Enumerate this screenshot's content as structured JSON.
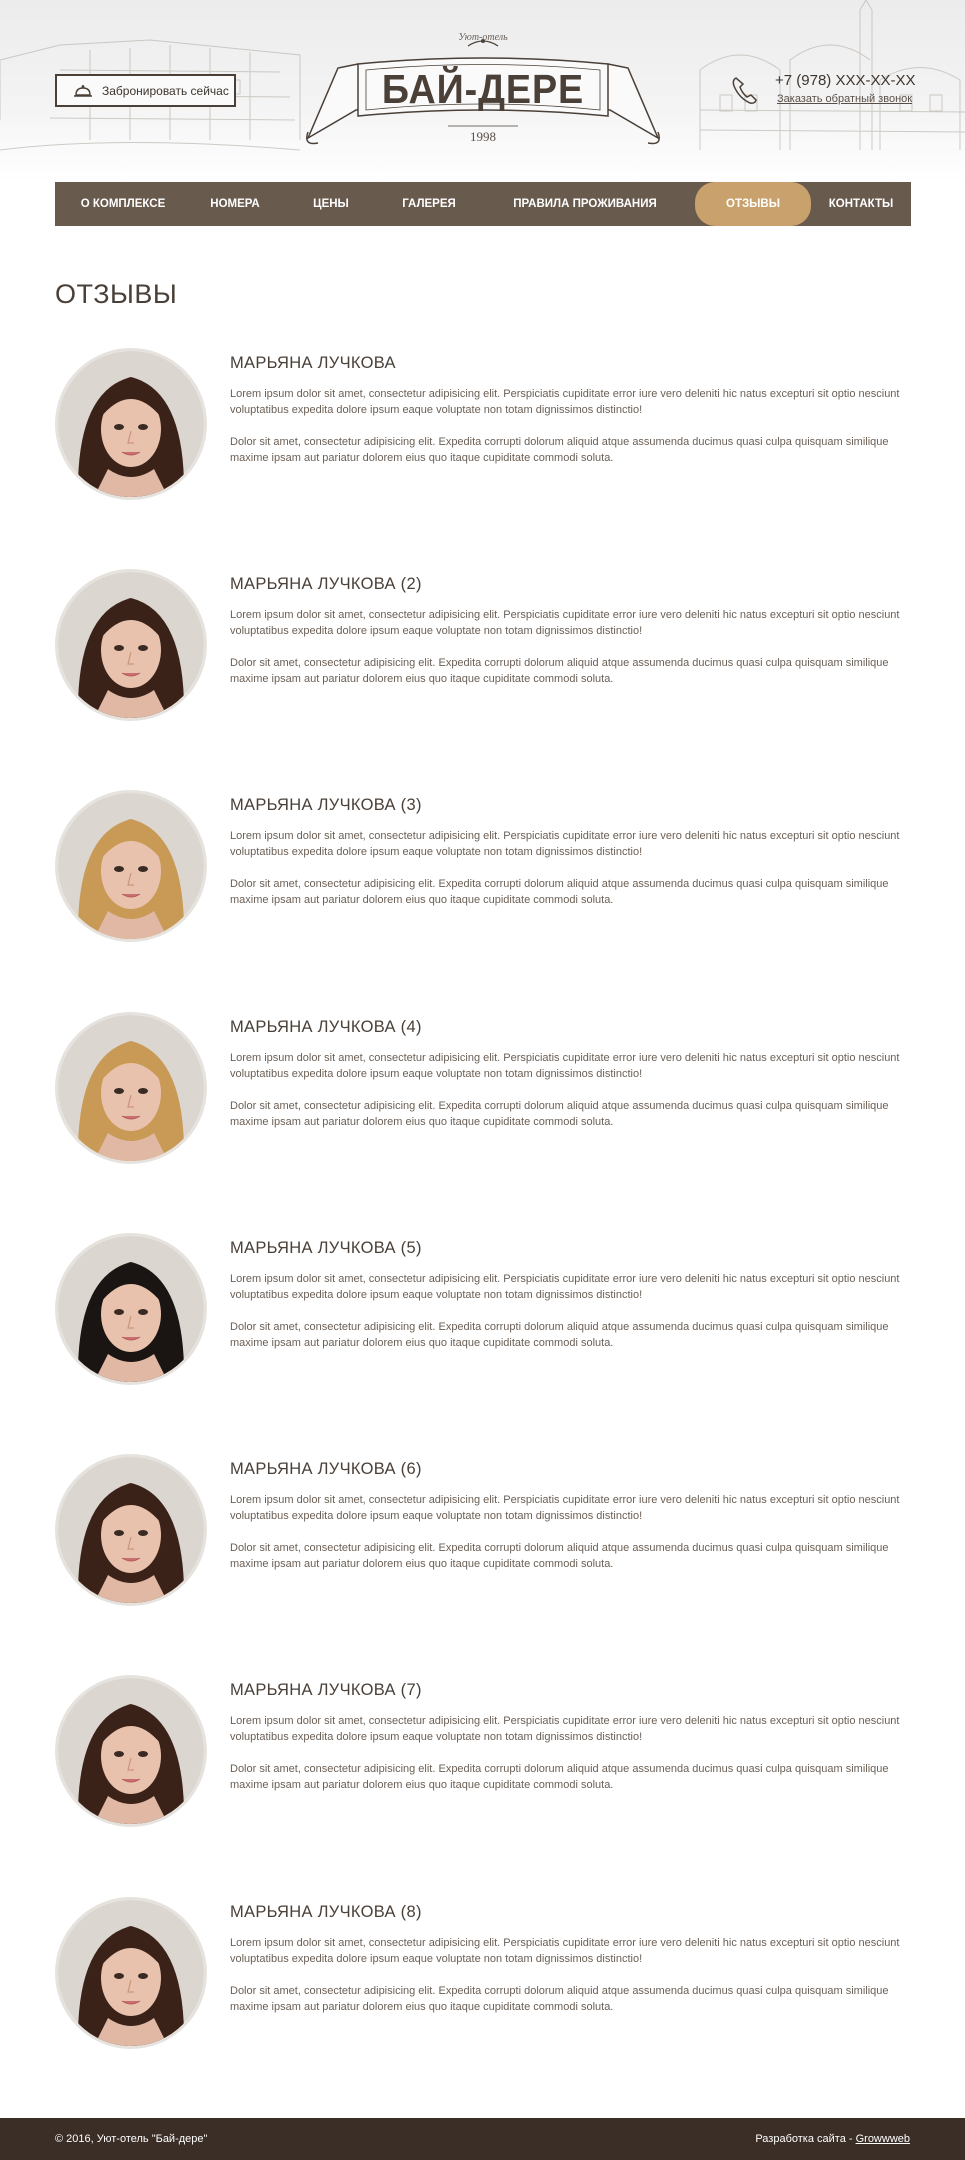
{
  "header": {
    "book_button": "Забронировать сейчас",
    "logo_subtitle": "Уют-отель",
    "logo_title": "БАЙ-ДЕРЕ",
    "logo_year": "1998",
    "phone": "+7 (978) XXX-XX-XX",
    "callback": "Заказать обратный звонок"
  },
  "nav": {
    "items": [
      {
        "label": "О комплексе"
      },
      {
        "label": "Номера"
      },
      {
        "label": "Цены"
      },
      {
        "label": "Галерея"
      },
      {
        "label": "Правила проживания"
      },
      {
        "label": "Отзывы",
        "active": true
      },
      {
        "label": "Контакты"
      }
    ]
  },
  "page": {
    "title": "ОТЗЫВЫ"
  },
  "reviews": [
    {
      "name": "МАРЬЯНА ЛУЧКОВА",
      "p1": "Lorem ipsum dolor sit amet, consectetur adipisicing elit. Perspiciatis cupiditate error iure vero deleniti hic natus excepturi sit optio nesciunt voluptatibus expedita dolore ipsum eaque voluptate non totam dignissimos distinctio!",
      "p2": "Dolor sit amet, consectetur adipisicing elit. Expedita corrupti dolorum aliquid atque assumenda ducimus quasi culpa quisquam similique maxime ipsam aut pariatur dolorem eius quo itaque cupiditate commodi soluta.",
      "hair": "dark-brown"
    },
    {
      "name": "МАРЬЯНА ЛУЧКОВА (2)",
      "p1": "Lorem ipsum dolor sit amet, consectetur adipisicing elit. Perspiciatis cupiditate error iure vero deleniti hic natus excepturi sit optio nesciunt voluptatibus expedita dolore ipsum eaque voluptate non totam dignissimos distinctio!",
      "p2": "Dolor sit amet, consectetur adipisicing elit. Expedita corrupti dolorum aliquid atque assumenda ducimus quasi culpa quisquam similique maxime ipsam aut pariatur dolorem eius quo itaque cupiditate commodi soluta.",
      "hair": "dark-brown"
    },
    {
      "name": "МАРЬЯНА ЛУЧКОВА (3)",
      "p1": "Lorem ipsum dolor sit amet, consectetur adipisicing elit. Perspiciatis cupiditate error iure vero deleniti hic natus excepturi sit optio nesciunt voluptatibus expedita dolore ipsum eaque voluptate non totam dignissimos distinctio!",
      "p2": "Dolor sit amet, consectetur adipisicing elit. Expedita corrupti dolorum aliquid atque assumenda ducimus quasi culpa quisquam similique maxime ipsam aut pariatur dolorem eius quo itaque cupiditate commodi soluta.",
      "hair": "blonde"
    },
    {
      "name": "МАРЬЯНА ЛУЧКОВА (4)",
      "p1": "Lorem ipsum dolor sit amet, consectetur adipisicing elit. Perspiciatis cupiditate error iure vero deleniti hic natus excepturi sit optio nesciunt voluptatibus expedita dolore ipsum eaque voluptate non totam dignissimos distinctio!",
      "p2": "Dolor sit amet, consectetur adipisicing elit. Expedita corrupti dolorum aliquid atque assumenda ducimus quasi culpa quisquam similique maxime ipsam aut pariatur dolorem eius quo itaque cupiditate commodi soluta.",
      "hair": "blonde"
    },
    {
      "name": "МАРЬЯНА ЛУЧКОВА (5)",
      "p1": "Lorem ipsum dolor sit amet, consectetur adipisicing elit. Perspiciatis cupiditate error iure vero deleniti hic natus excepturi sit optio nesciunt voluptatibus expedita dolore ipsum eaque voluptate non totam dignissimos distinctio!",
      "p2": "Dolor sit amet, consectetur adipisicing elit. Expedita corrupti dolorum aliquid atque assumenda ducimus quasi culpa quisquam similique maxime ipsam aut pariatur dolorem eius quo itaque cupiditate commodi soluta.",
      "hair": "black"
    },
    {
      "name": "МАРЬЯНА ЛУЧКОВА (6)",
      "p1": "Lorem ipsum dolor sit amet, consectetur adipisicing elit. Perspiciatis cupiditate error iure vero deleniti hic natus excepturi sit optio nesciunt voluptatibus expedita dolore ipsum eaque voluptate non totam dignissimos distinctio!",
      "p2": "Dolor sit amet, consectetur adipisicing elit. Expedita corrupti dolorum aliquid atque assumenda ducimus quasi culpa quisquam similique maxime ipsam aut pariatur dolorem eius quo itaque cupiditate commodi soluta.",
      "hair": "dark-brown"
    },
    {
      "name": "МАРЬЯНА ЛУЧКОВА (7)",
      "p1": "Lorem ipsum dolor sit amet, consectetur adipisicing elit. Perspiciatis cupiditate error iure vero deleniti hic natus excepturi sit optio nesciunt voluptatibus expedita dolore ipsum eaque voluptate non totam dignissimos distinctio!",
      "p2": "Dolor sit amet, consectetur adipisicing elit. Expedita corrupti dolorum aliquid atque assumenda ducimus quasi culpa quisquam similique maxime ipsam aut pariatur dolorem eius quo itaque cupiditate commodi soluta.",
      "hair": "dark-brown"
    },
    {
      "name": "МАРЬЯНА ЛУЧКОВА (8)",
      "p1": "Lorem ipsum dolor sit amet, consectetur adipisicing elit. Perspiciatis cupiditate error iure vero deleniti hic natus excepturi sit optio nesciunt voluptatibus expedita dolore ipsum eaque voluptate non totam dignissimos distinctio!",
      "p2": "Dolor sit amet, consectetur adipisicing elit. Expedita corrupti dolorum aliquid atque assumenda ducimus quasi culpa quisquam similique maxime ipsam aut pariatur dolorem eius quo itaque cupiditate commodi soluta.",
      "hair": "dark-brown"
    }
  ],
  "footer": {
    "copyright": "© 2016, Уют-отель \"Бай-дере\"",
    "dev_label": "Разработка сайта -",
    "dev_link": "Growwweb"
  },
  "colors": {
    "nav_bg": "#695a4e",
    "nav_active": "#c9a16c",
    "footer_bg": "#3a2e27",
    "text_dark": "#4a4038"
  }
}
